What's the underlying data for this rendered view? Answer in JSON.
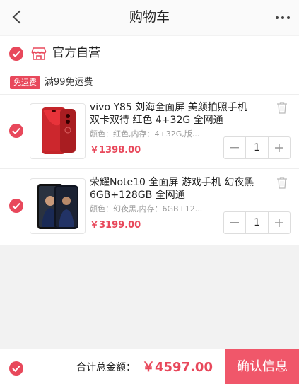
{
  "header": {
    "title": "购物车"
  },
  "store": {
    "name": "官方自营",
    "promo_tag": "免运费",
    "promo_text": "满99免运费"
  },
  "items": [
    {
      "name": "vivo Y85 刘海全面屏 美颜拍照手机 双卡双待 红色 4+32G 全网通",
      "spec": "颜色：红色,内存：4+32G,版...",
      "price": "￥1398.00",
      "quantity": "1",
      "image_color": "#d42a2e"
    },
    {
      "name": "荣耀Note10 全面屏 游戏手机 幻夜黑 6GB+128GB 全网通",
      "spec": "颜色：幻夜黑,内存：6GB+12...",
      "price": "￥3199.00",
      "quantity": "1",
      "image_color": "#1d2230"
    }
  ],
  "footer": {
    "total_label": "合计总金额：",
    "total_value": "￥4597.00",
    "confirm_label": "确认信息"
  },
  "colors": {
    "accent": "#e8485b",
    "confirm_bg": "#f0576a"
  },
  "icons": {
    "back": "chevron-left-icon",
    "more": "more-dots-icon",
    "check": "check-circle-icon",
    "shop": "shop-icon",
    "trash": "trash-icon",
    "minus": "minus-icon",
    "plus": "plus-icon"
  }
}
